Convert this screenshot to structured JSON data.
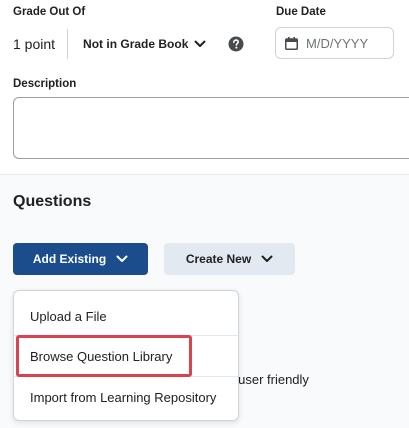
{
  "grade": {
    "label": "Grade Out Of",
    "points": "1 point",
    "gradebook_option": "Not in Grade Book"
  },
  "due_date": {
    "label": "Due Date",
    "placeholder": "M/D/YYYY"
  },
  "description": {
    "label": "Description",
    "value": ""
  },
  "questions": {
    "title": "Questions",
    "add_existing_label": "Add Existing",
    "create_new_label": "Create New",
    "background_text": "s user friendly"
  },
  "menu": {
    "items": [
      {
        "label": "Upload a File"
      },
      {
        "label": "Browse Question Library",
        "highlighted": true
      },
      {
        "label": "Import from Learning Repository"
      }
    ]
  },
  "colors": {
    "primary_button": "#1b4d8c",
    "secondary_button": "#e3e9f1",
    "highlight_border": "#d9424f"
  },
  "icons": {
    "gradebook_chevron": "chevron-down-icon",
    "help": "help-icon",
    "calendar": "calendar-icon",
    "add_existing_chevron": "chevron-down-icon",
    "create_new_chevron": "chevron-down-icon"
  }
}
